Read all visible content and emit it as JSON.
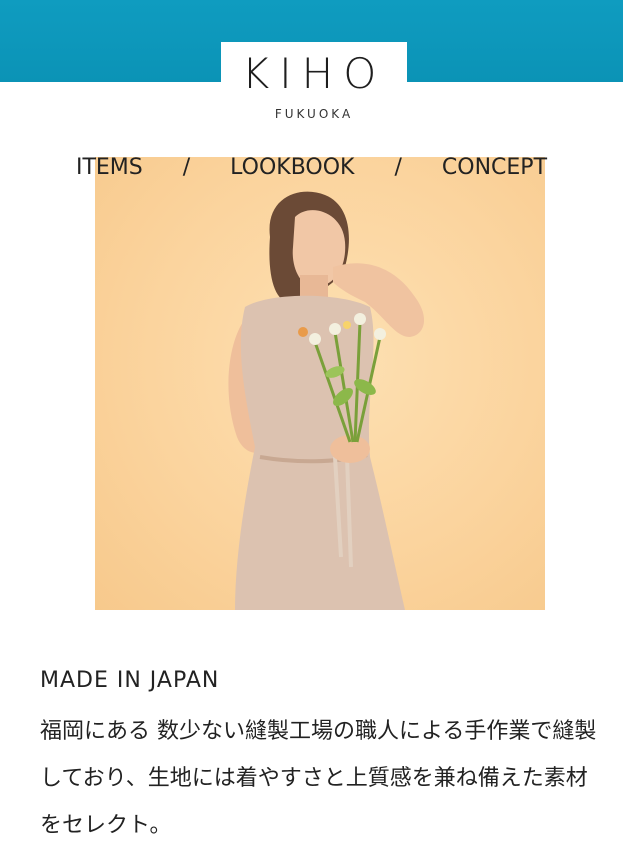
{
  "header": {
    "brand": "KIHO",
    "location": "FUKUOKA"
  },
  "nav": {
    "items": [
      "ITEMS",
      "LOOKBOOK",
      "CONCEPT"
    ],
    "separator": "/"
  },
  "hero": {
    "image": "woman-holding-flowers-photo"
  },
  "content": {
    "title": "MADE IN JAPAN",
    "body": "福岡にある 数少ない縫製工場の職人による手作業で縫製しており、生地には着やすさと上質感を兼ね備えた素材をセレクト。"
  },
  "colors": {
    "header_band": "#0f9cc0",
    "hero_background": "#fbd49e",
    "text": "#222222"
  }
}
